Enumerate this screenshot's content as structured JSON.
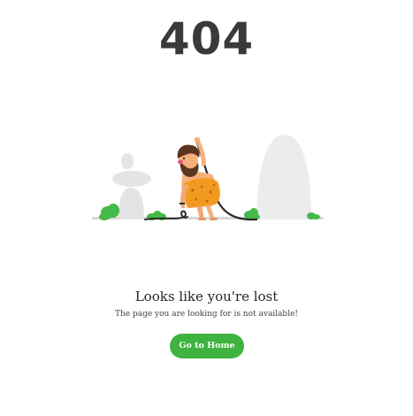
{
  "error": {
    "code": "404"
  },
  "message": {
    "headline": "Looks like you're lost",
    "subtext": "The page you are looking for is not available!"
  },
  "actions": {
    "home_label": "Go to Home"
  },
  "colors": {
    "accent": "#3fb33f",
    "heading": "#3a3a3a",
    "rock": "#e6e6e6",
    "skin": "#f6b07c",
    "loincloth": "#f29a1f",
    "hair": "#5a3520"
  },
  "illustration": {
    "icon": "lost-caveman-illustration"
  }
}
